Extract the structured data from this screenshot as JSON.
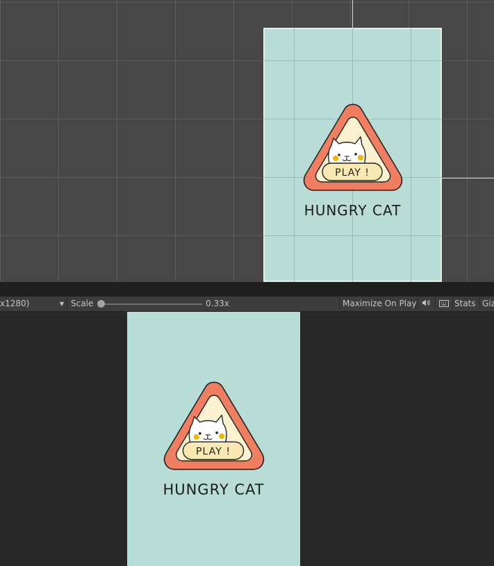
{
  "toolbar": {
    "resolution_label": "x1280)",
    "scale_label": "Scale",
    "scale_value_text": "0.33x",
    "scale_level": 0.0,
    "maximize_label": "Maximize On Play",
    "mute_icon": "speaker-icon",
    "keyboard_icon": "keyboard-icon",
    "stats_label": "Stats",
    "gizmos_label": "Giz"
  },
  "game_ui": {
    "play_label": "PLAY !",
    "title": "HUNGRY CAT"
  },
  "colors": {
    "canvas_background": "#b9dcd6",
    "badge_outer": "#f07f62",
    "badge_inner": "#fdf2cf",
    "button_fill": "#fbe9b3",
    "cheek": "#f4b400"
  }
}
